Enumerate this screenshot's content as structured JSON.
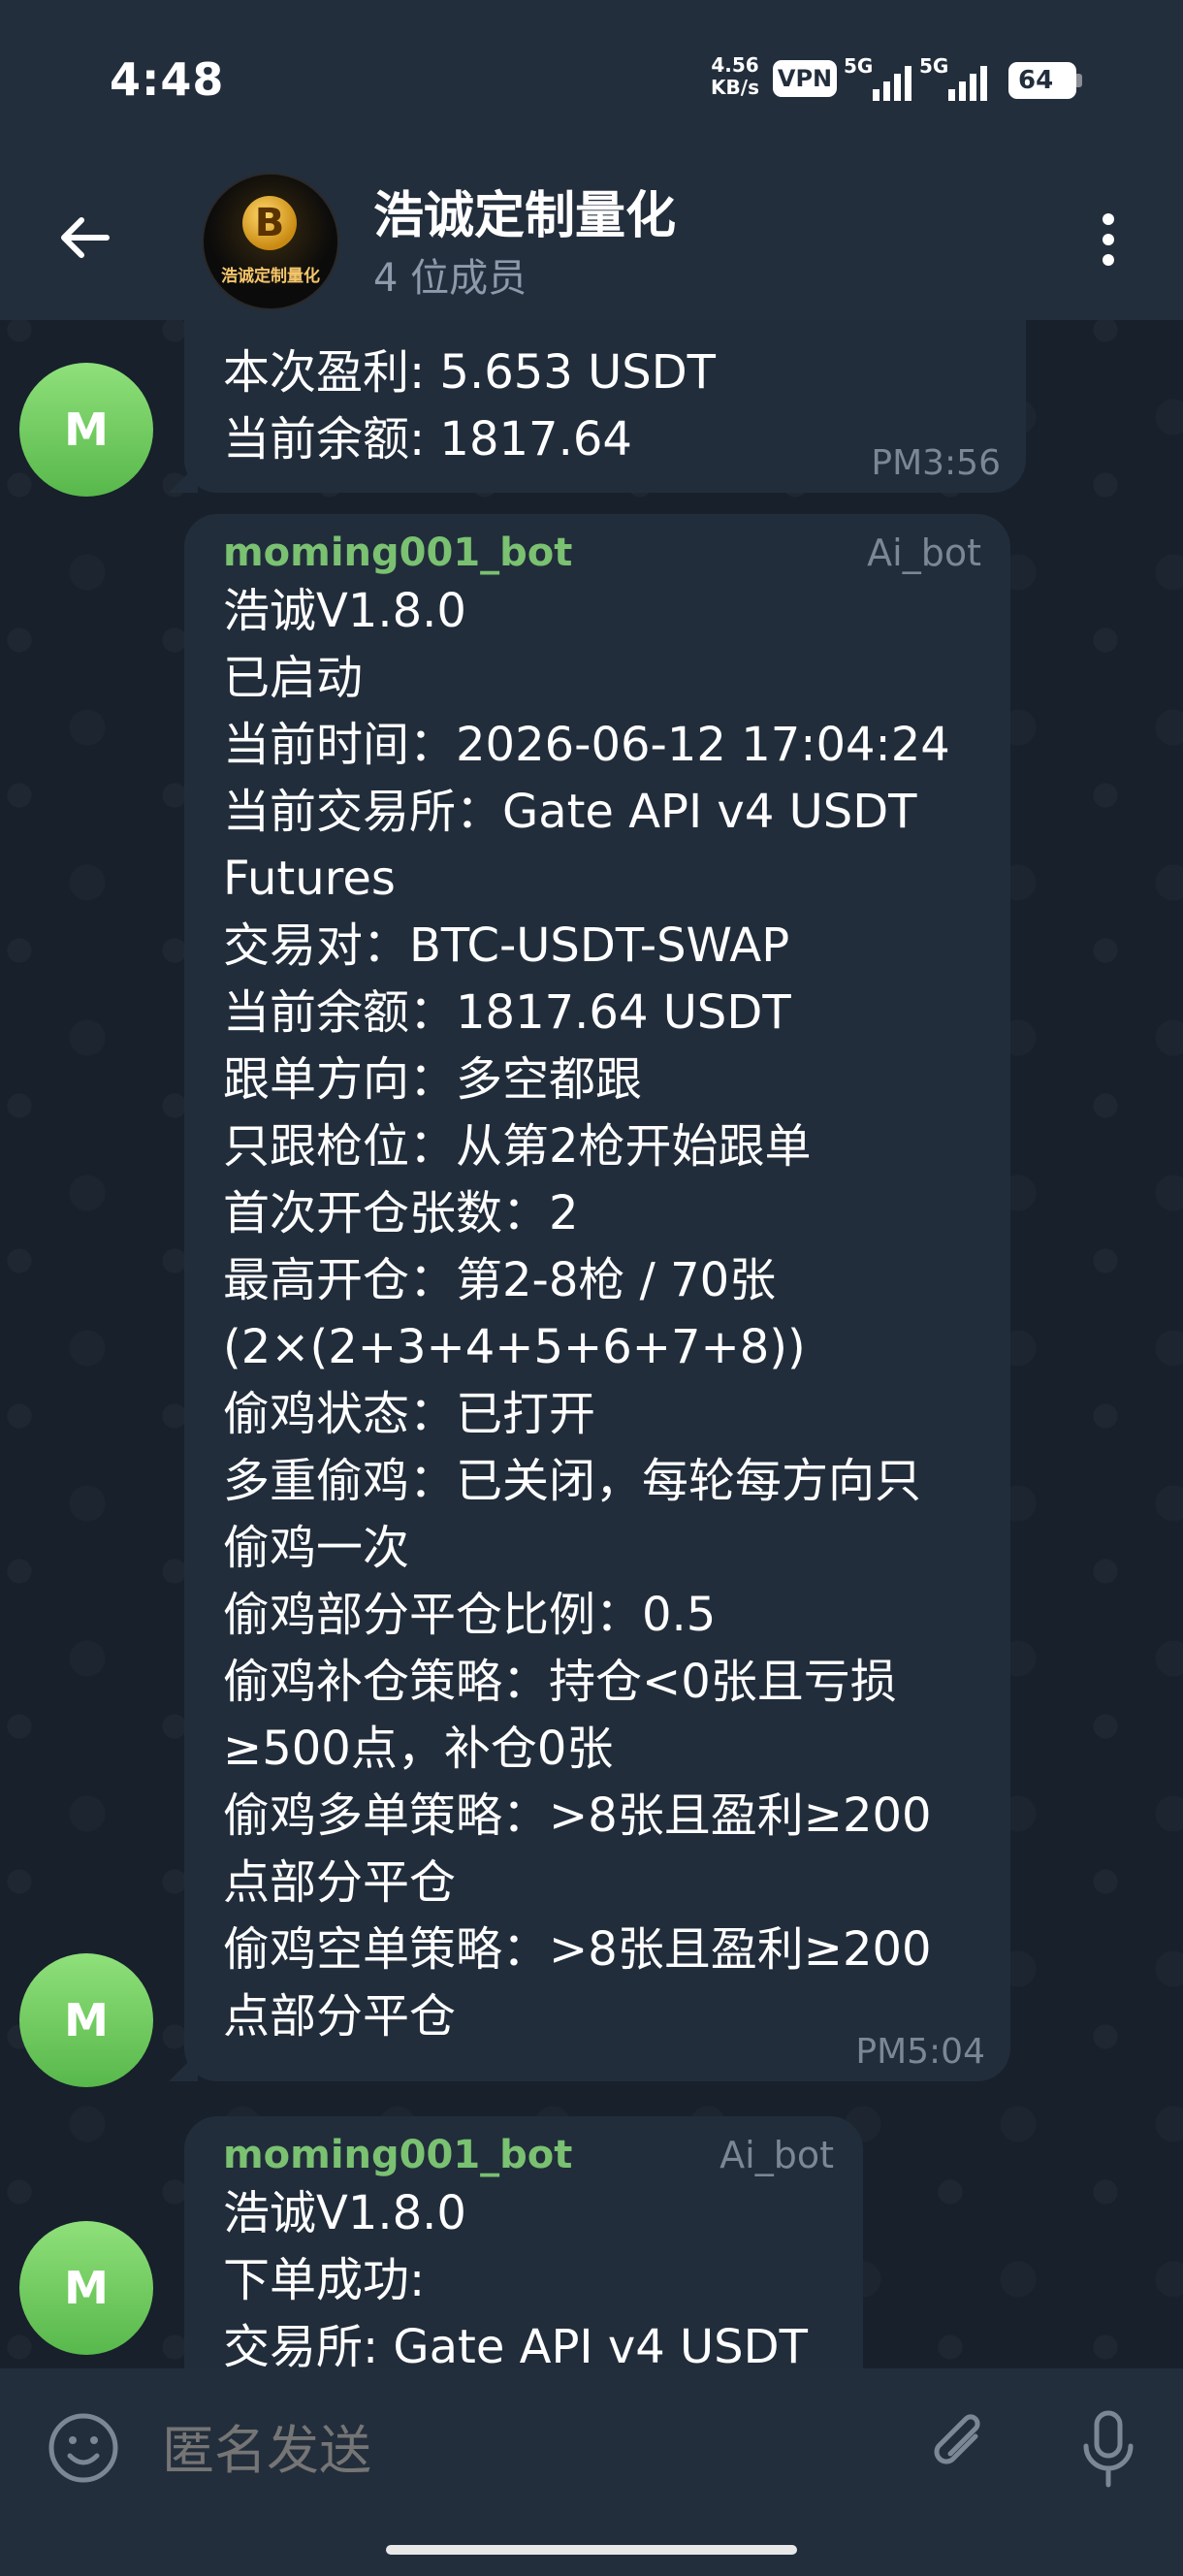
{
  "status_bar": {
    "time": "4:48",
    "net_speed_value": "4.56",
    "net_speed_unit": "KB/s",
    "vpn": "VPN",
    "signal1": "5G",
    "signal2": "5G",
    "battery": "64"
  },
  "header": {
    "title": "浩诚定制量化",
    "subtitle": "4 位成员",
    "avatar_logo_text": "浩诚定制量化",
    "avatar_coin": "B"
  },
  "messages": [
    {
      "avatar": "M",
      "sender": "",
      "badge": "",
      "lines": [
        "本次盈利: 5.653 USDT",
        "当前余额: 1817.64"
      ],
      "time": "PM3:56"
    },
    {
      "avatar": "M",
      "sender": "moming001_bot",
      "badge": "Ai_bot",
      "lines": [
        "浩诚V1.8.0",
        "已启动",
        "当前时间：2026-06-12 17:04:24",
        "当前交易所：Gate API v4 USDT",
        "Futures",
        "交易对：BTC-USDT-SWAP",
        "当前余额：1817.64 USDT",
        "跟单方向：多空都跟",
        "只跟枪位：从第2枪开始跟单",
        "首次开仓张数：2",
        "最高开仓：第2-8枪 / 70张",
        "(2×(2+3+4+5+6+7+8))",
        "偷鸡状态：已打开",
        "多重偷鸡：已关闭，每轮每方向只",
        "偷鸡一次",
        "偷鸡部分平仓比例：0.5",
        "偷鸡补仓策略：持仓<0张且亏损",
        "≥500点，补仓0张",
        "偷鸡多单策略：>8张且盈利≥200",
        "点部分平仓",
        "偷鸡空单策略：>8张且盈利≥200",
        "点部分平仓"
      ],
      "time": "PM5:04"
    },
    {
      "avatar": "M",
      "sender": "moming001_bot",
      "badge": "Ai_bot",
      "lines": [
        "浩诚V1.8.0",
        "下单成功:",
        "交易所: Gate API v4 USDT"
      ],
      "time": ""
    }
  ],
  "input": {
    "placeholder": "匿名发送"
  }
}
